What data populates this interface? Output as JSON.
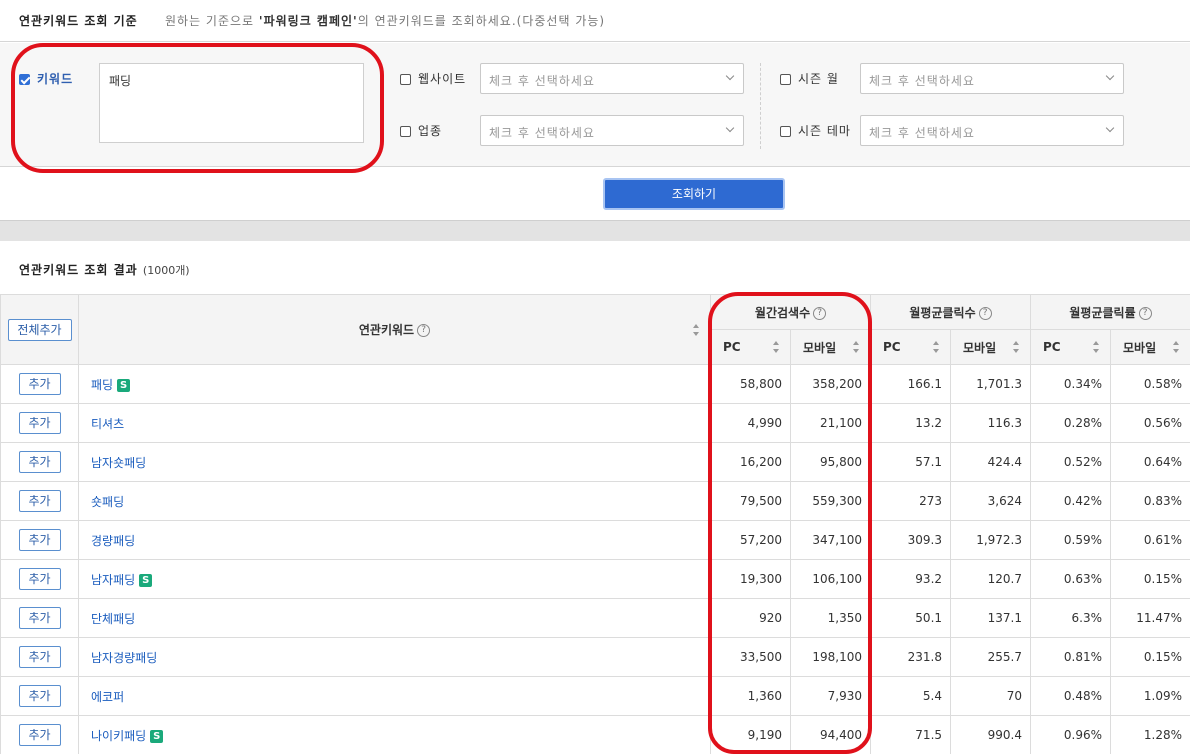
{
  "criteria": {
    "title": "연관키워드 조회 기준",
    "desc_prefix": "원하는 기준으로 ",
    "desc_bold": "'파워링크 캠페인'",
    "desc_suffix": "의 연관키워드를 조회하세요.(다중선택 가능)"
  },
  "filters": {
    "keyword": {
      "label": "키워드",
      "checked": true,
      "value": "패딩"
    },
    "website": {
      "label": "웹사이트",
      "placeholder": "체크 후 선택하세요"
    },
    "industry": {
      "label": "업종",
      "placeholder": "체크 후 선택하세요"
    },
    "season_month": {
      "label": "시즌 월",
      "placeholder": "체크 후 선택하세요"
    },
    "season_theme": {
      "label": "시즌 테마",
      "placeholder": "체크 후 선택하세요"
    }
  },
  "search_button": "조회하기",
  "results": {
    "title": "연관키워드 조회 결과",
    "count": "(1000개)",
    "add_all": "전체추가",
    "add_label": "추가",
    "badge": "S",
    "help_glyph": "?",
    "headers": {
      "keyword": "연관키워드",
      "monthly_search": "월간검색수",
      "avg_clicks": "월평균클릭수",
      "avg_ctr": "월평균클릭률",
      "pc": "PC",
      "mobile": "모바일"
    },
    "rows": [
      {
        "keyword": "패딩",
        "badge": true,
        "pc": "58,800",
        "mobile": "358,200",
        "click_pc": "166.1",
        "click_mobile": "1,701.3",
        "ctr_pc": "0.34%",
        "ctr_mobile": "0.58%"
      },
      {
        "keyword": "티셔츠",
        "badge": false,
        "pc": "4,990",
        "mobile": "21,100",
        "click_pc": "13.2",
        "click_mobile": "116.3",
        "ctr_pc": "0.28%",
        "ctr_mobile": "0.56%"
      },
      {
        "keyword": "남자숏패딩",
        "badge": false,
        "pc": "16,200",
        "mobile": "95,800",
        "click_pc": "57.1",
        "click_mobile": "424.4",
        "ctr_pc": "0.52%",
        "ctr_mobile": "0.64%"
      },
      {
        "keyword": "숏패딩",
        "badge": false,
        "pc": "79,500",
        "mobile": "559,300",
        "click_pc": "273",
        "click_mobile": "3,624",
        "ctr_pc": "0.42%",
        "ctr_mobile": "0.83%"
      },
      {
        "keyword": "경량패딩",
        "badge": false,
        "pc": "57,200",
        "mobile": "347,100",
        "click_pc": "309.3",
        "click_mobile": "1,972.3",
        "ctr_pc": "0.59%",
        "ctr_mobile": "0.61%"
      },
      {
        "keyword": "남자패딩",
        "badge": true,
        "pc": "19,300",
        "mobile": "106,100",
        "click_pc": "93.2",
        "click_mobile": "120.7",
        "ctr_pc": "0.63%",
        "ctr_mobile": "0.15%"
      },
      {
        "keyword": "단체패딩",
        "badge": false,
        "pc": "920",
        "mobile": "1,350",
        "click_pc": "50.1",
        "click_mobile": "137.1",
        "ctr_pc": "6.3%",
        "ctr_mobile": "11.47%"
      },
      {
        "keyword": "남자경량패딩",
        "badge": false,
        "pc": "33,500",
        "mobile": "198,100",
        "click_pc": "231.8",
        "click_mobile": "255.7",
        "ctr_pc": "0.81%",
        "ctr_mobile": "0.15%"
      },
      {
        "keyword": "에코퍼",
        "badge": false,
        "pc": "1,360",
        "mobile": "7,930",
        "click_pc": "5.4",
        "click_mobile": "70",
        "ctr_pc": "0.48%",
        "ctr_mobile": "1.09%"
      },
      {
        "keyword": "나이키패딩",
        "badge": true,
        "pc": "9,190",
        "mobile": "94,400",
        "click_pc": "71.5",
        "click_mobile": "990.4",
        "ctr_pc": "0.96%",
        "ctr_mobile": "1.28%"
      }
    ]
  },
  "colors": {
    "annotation_red": "#e0111b",
    "primary_blue": "#2e6ad2",
    "badge_green": "#1aa97b",
    "link_blue": "#1a5cbe"
  },
  "icons": {
    "sort": "sort-icon",
    "help": "help-circle-icon",
    "dropdown": "chevron-down-icon",
    "checkbox": "checkbox-icon"
  }
}
